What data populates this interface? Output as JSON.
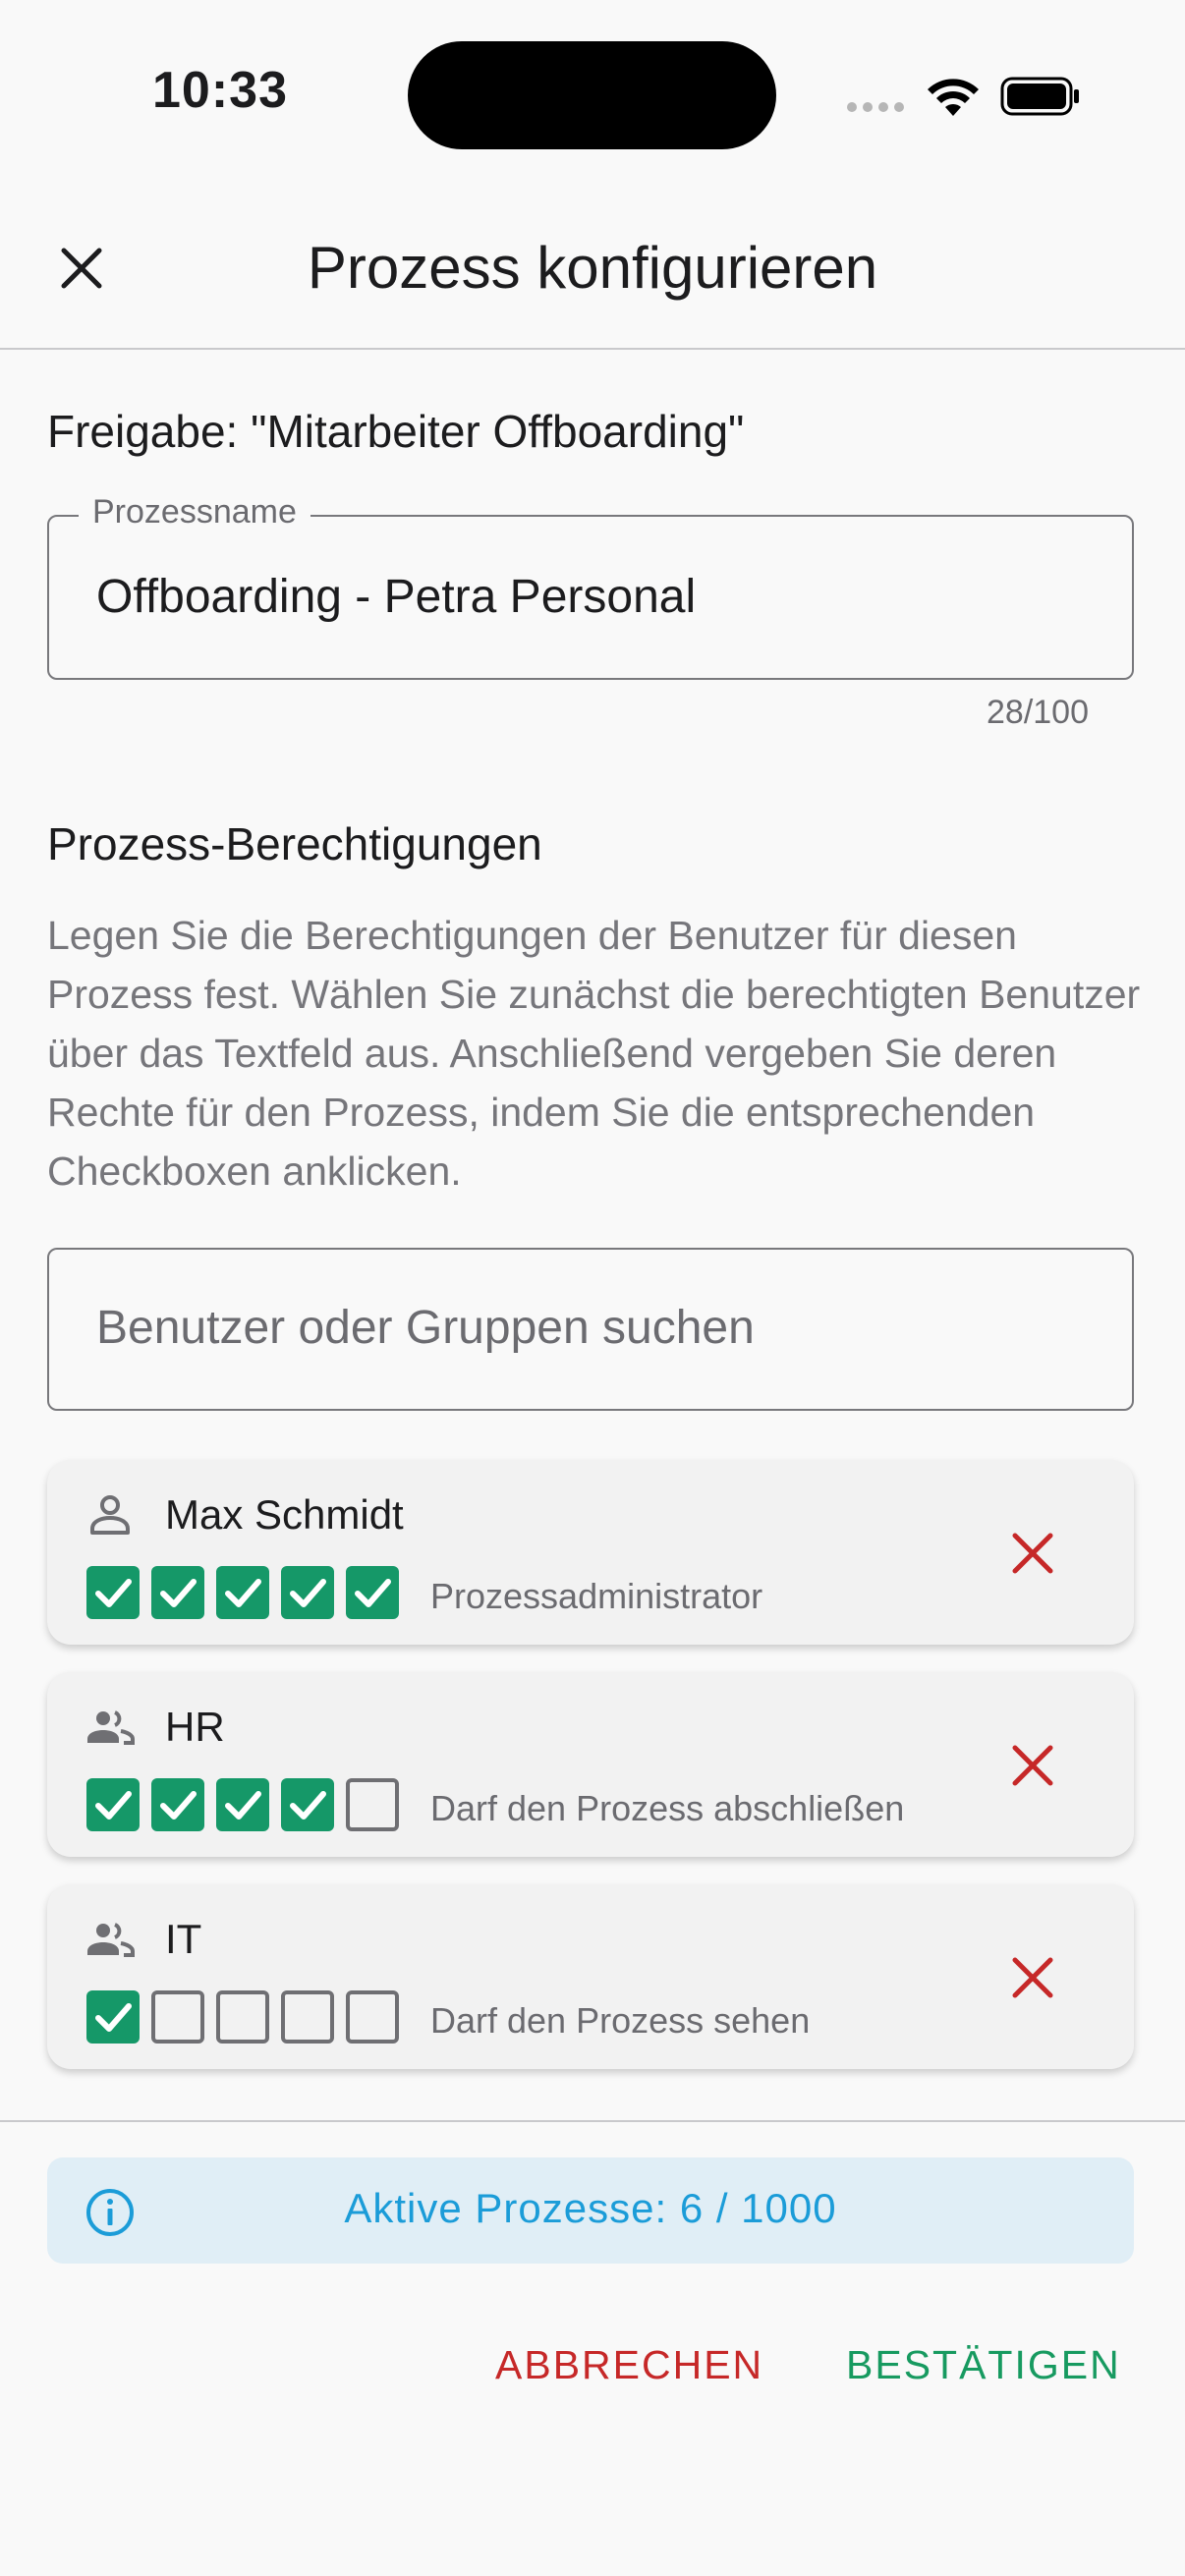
{
  "status_bar": {
    "time": "10:33"
  },
  "header": {
    "title": "Prozess konfigurieren",
    "close_icon": "close-icon"
  },
  "share": {
    "title": "Freigabe: \"Mitarbeiter Offboarding\""
  },
  "process_name_field": {
    "label": "Prozessname",
    "value": "Offboarding - Petra Personal",
    "counter": "28/100"
  },
  "permissions": {
    "title": "Prozess-Berechtigungen",
    "description": "Legen Sie die Berechtigungen der Benutzer für diesen Prozess fest. Wählen Sie zunächst die berechtigten Benutzer über das Textfeld aus. Anschließend vergeben Sie deren Rechte für den Prozess, indem Sie die entsprechenden Checkboxen anklicken.",
    "search_placeholder": "Benutzer oder Gruppen suchen",
    "entries": [
      {
        "name": "Max Schmidt",
        "type": "user",
        "icon": "person-icon",
        "checks": [
          true,
          true,
          true,
          true,
          true
        ],
        "role": "Prozessadministrator"
      },
      {
        "name": "HR",
        "type": "group",
        "icon": "group-icon",
        "checks": [
          true,
          true,
          true,
          true,
          false
        ],
        "role": "Darf den Prozess abschließen"
      },
      {
        "name": "IT",
        "type": "group",
        "icon": "group-icon",
        "checks": [
          true,
          false,
          false,
          false,
          false
        ],
        "role": "Darf den Prozess sehen"
      }
    ]
  },
  "info": {
    "text": "Aktive Prozesse: 6 / 1000",
    "icon": "info-icon"
  },
  "actions": {
    "cancel": "ABBRECHEN",
    "confirm": "BESTÄTIGEN"
  },
  "colors": {
    "accent_green": "#159868",
    "danger_red": "#c62828",
    "info_blue": "#1b9cd8",
    "info_bg": "#e0eef6"
  }
}
